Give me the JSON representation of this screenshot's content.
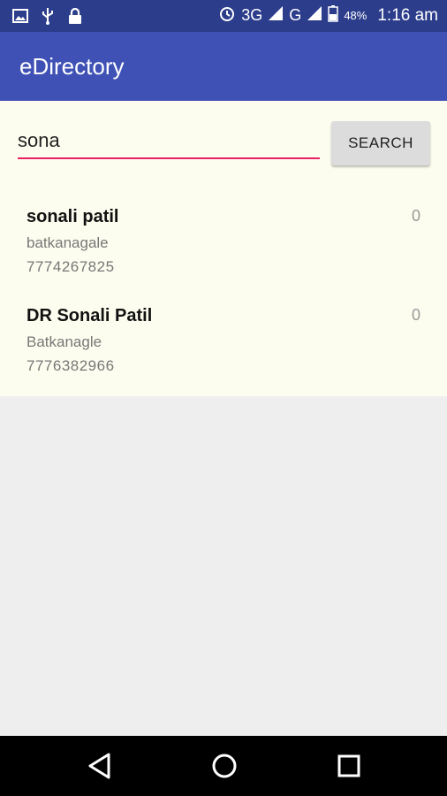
{
  "status_bar": {
    "network_3g": "3G",
    "network_g": "G",
    "battery": "48%",
    "time": "1:16 am"
  },
  "app_bar": {
    "title": "eDirectory"
  },
  "search": {
    "value": "sona",
    "button_label": "SEARCH"
  },
  "results": [
    {
      "name": "sonali patil",
      "place": "batkanagale",
      "phone": "7774267825",
      "count": "0"
    },
    {
      "name": "DR Sonali Patil",
      "place": "Batkanagle",
      "phone": "7776382966",
      "count": "0"
    }
  ],
  "nav_icons": [
    "back-icon",
    "home-icon",
    "recents-icon"
  ]
}
